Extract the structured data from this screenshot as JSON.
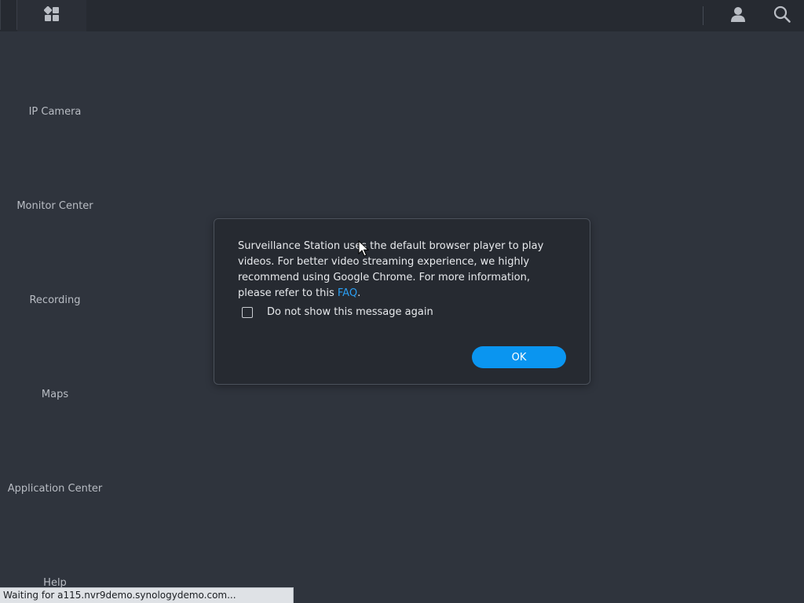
{
  "topbar": {
    "launcher_icon": "grid-icon",
    "user_icon": "user-icon",
    "search_icon": "search-icon"
  },
  "sidebar": {
    "items": [
      {
        "label": "IP Camera"
      },
      {
        "label": "Monitor Center"
      },
      {
        "label": "Recording"
      },
      {
        "label": "Maps"
      },
      {
        "label": "Application Center"
      },
      {
        "label": "Help"
      }
    ]
  },
  "dialog": {
    "message_prefix": "Surveillance Station uses the default browser player to play videos. For better video streaming experience, we highly recommend using Google Chrome. For more information, please refer to this ",
    "link_text": "FAQ",
    "message_suffix": ".",
    "checkbox_label": "Do not show this message again",
    "checkbox_checked": false,
    "ok_label": "OK"
  },
  "statusbar": {
    "text": "Waiting for a115.nvr9demo.synologydemo.com..."
  },
  "colors": {
    "background": "#2f343d",
    "topbar": "#262a31",
    "dialog_bg": "#262a31",
    "accent": "#0a95f0",
    "link": "#2a9ef2"
  }
}
